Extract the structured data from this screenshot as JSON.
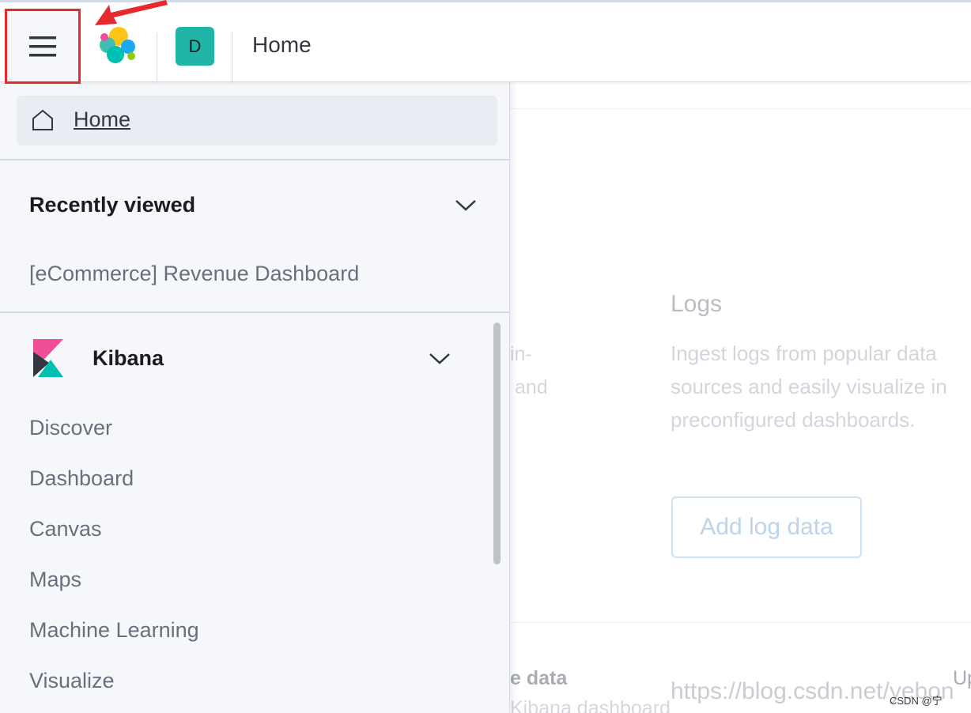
{
  "header": {
    "menu_button": "menu-icon",
    "logo": "elastic-logo",
    "avatar_letter": "D",
    "breadcrumb": "Home"
  },
  "nav": {
    "home_label": "Home",
    "recently_viewed": {
      "title": "Recently viewed",
      "items": [
        "[eCommerce] Revenue Dashboard"
      ]
    },
    "kibana": {
      "title": "Kibana",
      "items": [
        "Discover",
        "Dashboard",
        "Canvas",
        "Maps",
        "Machine Learning",
        "Visualize"
      ]
    }
  },
  "background": {
    "fragment_1": "in-",
    "fragment_2": "and",
    "logs_title": "Logs",
    "logs_description": [
      "Ingest logs from popular data",
      "sources and easily visualize in",
      "preconfigured dashboards."
    ],
    "add_log_button": "Add log data",
    "bottom_fragment": "e data",
    "bottom_fragment_2": "Kibana dashboard",
    "bottom_fragment_3": "Up"
  },
  "watermark": "https://blog.csdn.net/yebon",
  "credit": "CSDN @宁"
}
